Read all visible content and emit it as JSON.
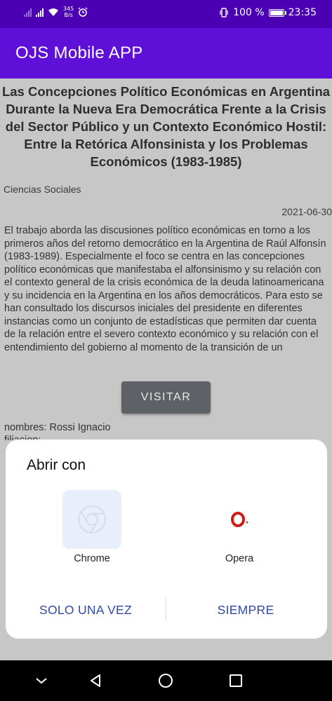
{
  "status_bar": {
    "net_speed_value": "345",
    "net_speed_unit": "B/s",
    "battery_percent": "100 %",
    "time": "23:35"
  },
  "app_bar": {
    "title": "OJS Mobile APP"
  },
  "article": {
    "title": "Las Concepciones Político Económicas en Argentina Durante la Nueva Era Democrática Frente a la Crisis del Sector Público y un Contexto Económico Hostil: Entre la Retórica Alfonsinista y los Problemas Económicos (1983-1985)",
    "category": "Ciencias Sociales",
    "date": "2021-06-30",
    "abstract": "El trabajo aborda las discusiones político económicas en torno a los primeros años del retorno democrático en la Argentina de Raúl Alfonsín (1983-1989). Especialmente el foco se centra en las concepciones político económicas que manifestaba el alfonsinismo y su relación con el contexto general de la crisis económica de la deuda latinoamericana y su incidencia en la Argentina en los años democráticos. Para esto se han consultado los discursos iniciales del presidente en diferentes instancias como un conjunto de estadísticas que permiten dar cuenta de la relación entre el severo contexto económico y su relación con el entendimiento del gobierno al momento de la transición de un",
    "visit_label": "VISITAR",
    "authors": "nombres: Rossi Ignacio",
    "affiliation": "filiacion:"
  },
  "open_with_sheet": {
    "title": "Abrir con",
    "apps": [
      {
        "name": "Chrome",
        "icon": "chrome-icon"
      },
      {
        "name": "Opera",
        "icon": "opera-icon"
      }
    ],
    "once_label": "SOLO UNA VEZ",
    "always_label": "SIEMPRE",
    "accent_color": "#2e4aa6"
  },
  "nav_bar": {
    "icons": [
      "collapse-icon",
      "back-icon",
      "home-icon",
      "recents-icon"
    ]
  },
  "colors": {
    "status_bar": "#4b00b4",
    "app_bar": "#5f10d8",
    "scrim_background": "#c7c7c7",
    "visit_button": "#5e6266"
  }
}
